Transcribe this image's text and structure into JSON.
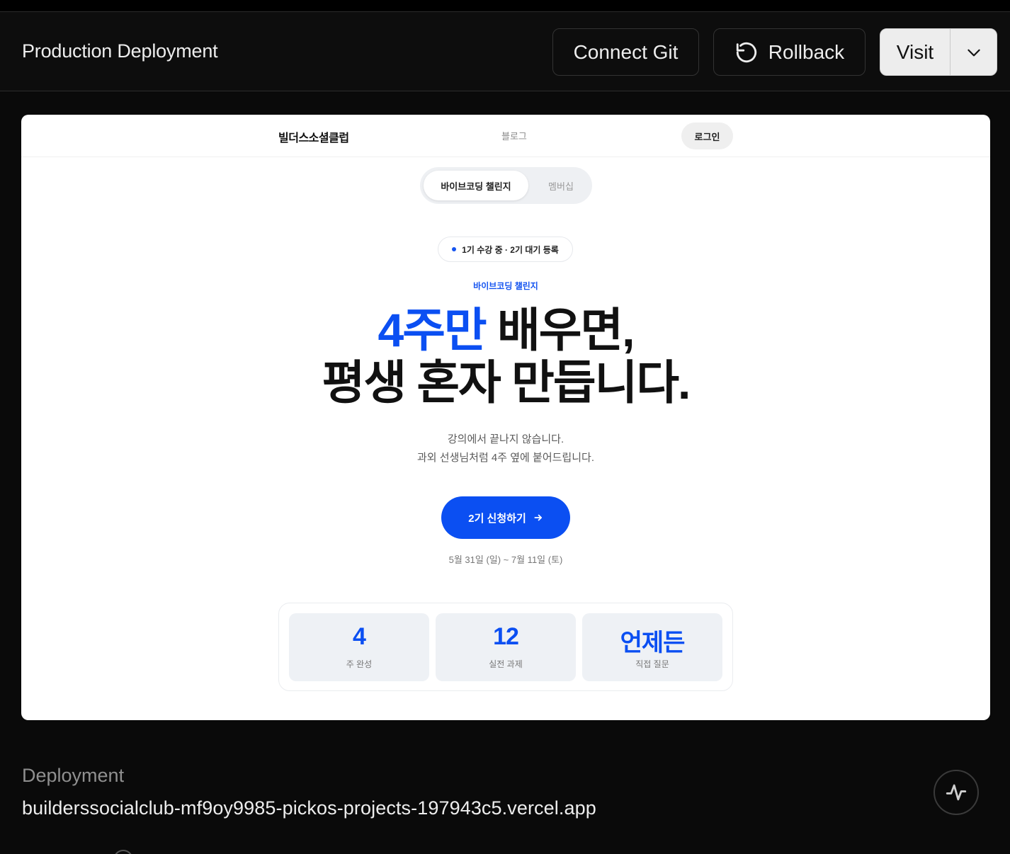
{
  "header": {
    "title": "Production Deployment",
    "connect_git": "Connect Git",
    "rollback": "Rollback",
    "visit": "Visit"
  },
  "preview": {
    "nav": {
      "logo": "빌더스소셜클럽",
      "blog": "블로그",
      "login": "로그인"
    },
    "tabs": {
      "active": "바이브코딩 챌린지",
      "other": "멤버십"
    },
    "badge": "1기 수강 중 · 2기 대기 등록",
    "kicker": "바이브코딩 챌린지",
    "hero": {
      "accent": "4주만",
      "line1_rest": " 배우면,",
      "line2": "평생 혼자 만듭니다."
    },
    "sub": {
      "line1": "강의에서 끝나지 않습니다.",
      "line2": "과외 선생님처럼 4주 옆에 붙어드립니다."
    },
    "cta": "2기 신청하기",
    "date": "5월 31일 (일) ~ 7월 11일 (토)",
    "stats": [
      {
        "value": "4",
        "label": "주 완성"
      },
      {
        "value": "12",
        "label": "실전 과제"
      },
      {
        "value": "언제든",
        "label": "직접 질문"
      }
    ]
  },
  "deployment": {
    "label": "Deployment",
    "url": "builderssocialclub-mf9oy9985-pickos-projects-197943c5.vercel.app"
  },
  "colors": {
    "accent": "#0b4ff2",
    "background": "#0a0a0a"
  }
}
